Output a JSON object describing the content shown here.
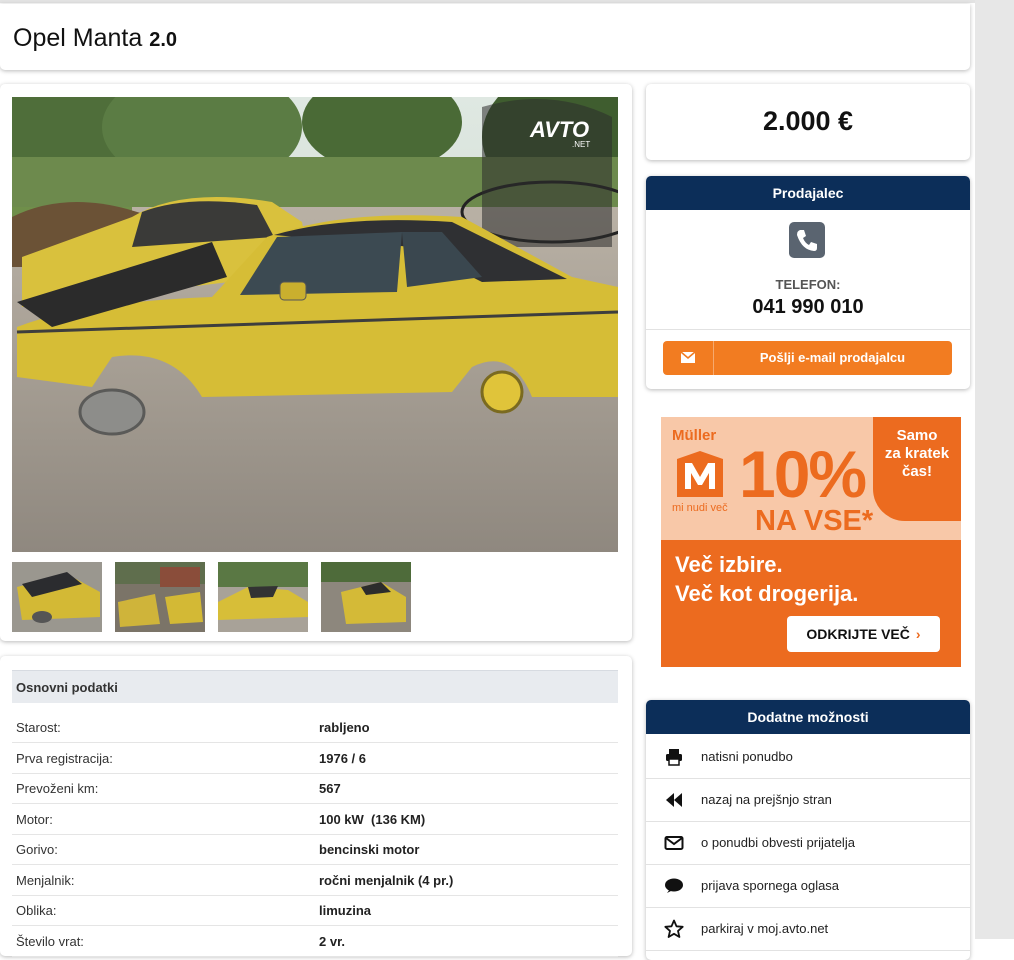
{
  "listing": {
    "title": "Opel Manta",
    "version": "2.0",
    "price": "2.000 €"
  },
  "gallery": {
    "watermark": "AVTO",
    "watermark_sub": ".NET",
    "thumbnail_count": 4
  },
  "seller": {
    "header": "Prodajalec",
    "phone_label": "TELEFON:",
    "phone_number": "041 990 010",
    "email_button": "Pošlji e-mail prodajalcu",
    "phone_icon": "phone-icon",
    "email_icon": "envelope-icon"
  },
  "ad": {
    "brand": "Müller",
    "brand_tagline": "mi nudi več",
    "discount": "10%",
    "discount_suffix": "NA VSE*",
    "badge_line1": "Samo",
    "badge_line2": "za kratek",
    "badge_line3": "čas!",
    "headline_line1": "Več izbire.",
    "headline_line2": "Več kot drogerija.",
    "button": "ODKRIJTE VEČ",
    "brand_color": "#ec6b1f"
  },
  "specs": {
    "header": "Osnovni podatki",
    "rows": [
      {
        "label": "Starost:",
        "value": "rabljeno"
      },
      {
        "label": "Prva registracija:",
        "value": "1976 / 6"
      },
      {
        "label": "Prevoženi km:",
        "value": "567"
      },
      {
        "label": "Motor:",
        "value": "100 kW  (136 KM)"
      },
      {
        "label": "Gorivo:",
        "value": "bencinski motor"
      },
      {
        "label": "Menjalnik:",
        "value": "ročni menjalnik (4 pr.)"
      },
      {
        "label": "Oblika:",
        "value": "limuzina"
      },
      {
        "label": "Število vrat:",
        "value": "2 vr."
      }
    ]
  },
  "options": {
    "header": "Dodatne možnosti",
    "items": [
      {
        "label": "natisni ponudbo",
        "icon": "printer-icon"
      },
      {
        "label": "nazaj na prejšnjo stran",
        "icon": "backward-icon"
      },
      {
        "label": "o ponudbi obvesti prijatelja",
        "icon": "envelope-icon"
      },
      {
        "label": "prijava spornega oglasa",
        "icon": "comment-icon"
      },
      {
        "label": "parkiraj v moj.avto.net",
        "icon": "star-icon"
      }
    ]
  },
  "colors": {
    "navy": "#0c2e59",
    "accent_orange": "#f27c21"
  }
}
